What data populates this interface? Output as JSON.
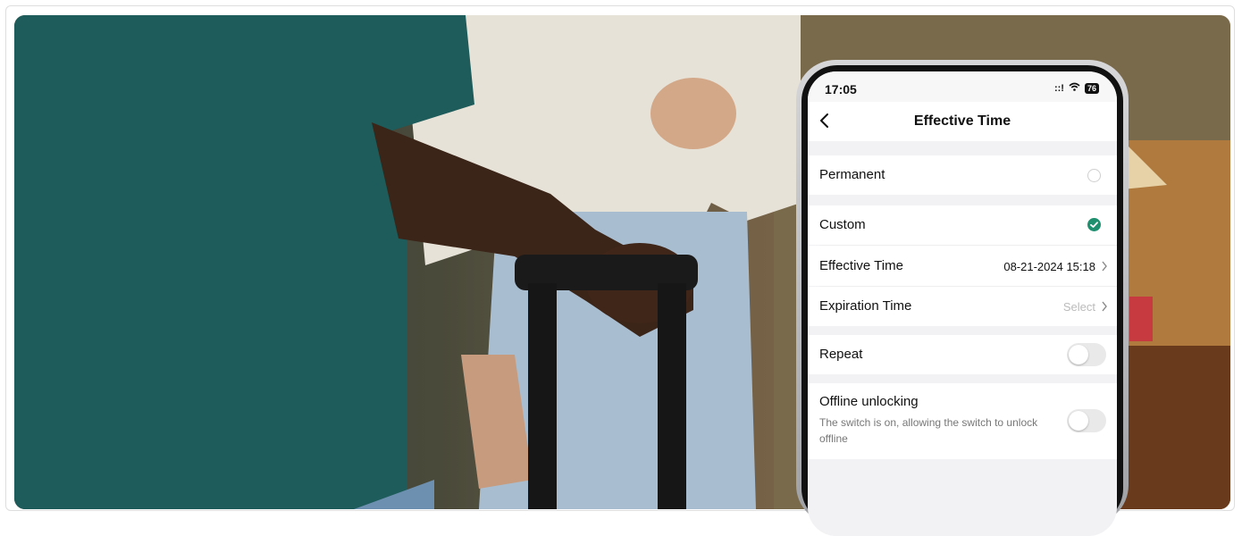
{
  "status_bar": {
    "time": "17:05",
    "signal": "::!",
    "wifi": "wifi",
    "battery": "76"
  },
  "nav": {
    "title": "Effective Time",
    "back_icon": "chevron-left-icon"
  },
  "permanent": {
    "label": "Permanent",
    "selected": false
  },
  "custom": {
    "label": "Custom",
    "selected": true
  },
  "effective_time": {
    "label": "Effective Time",
    "value": "08-21-2024 15:18"
  },
  "expiration_time": {
    "label": "Expiration Time",
    "value": "Select"
  },
  "repeat": {
    "label": "Repeat",
    "on": false
  },
  "offline_unlocking": {
    "label": "Offline unlocking",
    "description": "The switch is on, allowing the switch to unlock offline",
    "on": false
  },
  "colors": {
    "accent": "#1f8f6e",
    "muted_text": "#bbbbbb"
  }
}
